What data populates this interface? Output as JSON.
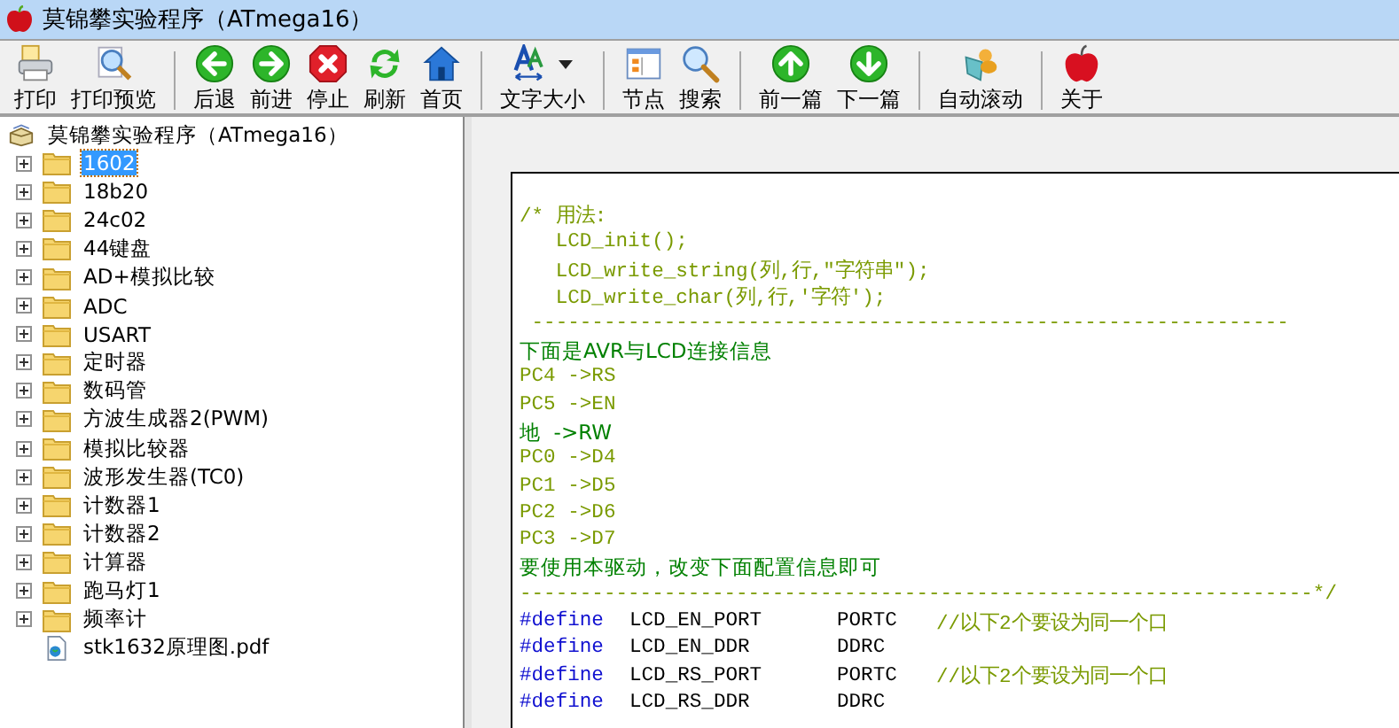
{
  "window": {
    "title": "莫锦攀实验程序（ATmega16）"
  },
  "toolbar": {
    "groups": [
      [
        {
          "label": "打印"
        },
        {
          "label": "打印预览"
        }
      ],
      [
        {
          "label": "后退"
        },
        {
          "label": "前进"
        },
        {
          "label": "停止"
        },
        {
          "label": "刷新"
        },
        {
          "label": "首页"
        }
      ],
      [
        {
          "label": "文字大小",
          "dropdown": true
        }
      ],
      [
        {
          "label": "节点"
        },
        {
          "label": "搜索"
        }
      ],
      [
        {
          "label": "前一篇"
        },
        {
          "label": "下一篇"
        }
      ],
      [
        {
          "label": "自动滚动"
        }
      ],
      [
        {
          "label": "关于"
        }
      ]
    ]
  },
  "tree": {
    "root": {
      "label": "莫锦攀实验程序（ATmega16）",
      "children": [
        {
          "label": "1602",
          "kind": "folder",
          "expanded": false,
          "selected": true
        },
        {
          "label": "18b20",
          "kind": "folder",
          "expanded": false,
          "selected": false
        },
        {
          "label": "24c02",
          "kind": "folder",
          "expanded": false,
          "selected": false
        },
        {
          "label": "44键盘",
          "kind": "folder",
          "expanded": false,
          "selected": false
        },
        {
          "label": "AD+模拟比较",
          "kind": "folder",
          "expanded": false,
          "selected": false
        },
        {
          "label": "ADC",
          "kind": "folder",
          "expanded": false,
          "selected": false
        },
        {
          "label": "USART",
          "kind": "folder",
          "expanded": false,
          "selected": false
        },
        {
          "label": "定时器",
          "kind": "folder",
          "expanded": false,
          "selected": false
        },
        {
          "label": "数码管",
          "kind": "folder",
          "expanded": false,
          "selected": false
        },
        {
          "label": "方波生成器2(PWM)",
          "kind": "folder",
          "expanded": false,
          "selected": false
        },
        {
          "label": "模拟比较器",
          "kind": "folder",
          "expanded": false,
          "selected": false
        },
        {
          "label": "波形发生器(TC0)",
          "kind": "folder",
          "expanded": false,
          "selected": false
        },
        {
          "label": "计数器1",
          "kind": "folder",
          "expanded": false,
          "selected": false
        },
        {
          "label": "计数器2",
          "kind": "folder",
          "expanded": false,
          "selected": false
        },
        {
          "label": "计算器",
          "kind": "folder",
          "expanded": false,
          "selected": false
        },
        {
          "label": "跑马灯1",
          "kind": "folder",
          "expanded": false,
          "selected": false
        },
        {
          "label": "频率计",
          "kind": "folder",
          "expanded": false,
          "selected": false
        },
        {
          "label": "stk1632原理图.pdf",
          "kind": "file",
          "selected": false
        }
      ]
    }
  },
  "code": {
    "lines": [
      {
        "kind": "comment",
        "text": "/* 用法:"
      },
      {
        "kind": "comment",
        "text": "   LCD_init();"
      },
      {
        "kind": "comment",
        "text": "   LCD_write_string(列,行,\"字符串\");"
      },
      {
        "kind": "comment",
        "text": "   LCD_write_char(列,行,'字符');"
      },
      {
        "kind": "comment",
        "text": " ---------------------------------------------------------------"
      },
      {
        "kind": "note",
        "text": "下面是AVR与LCD连接信息"
      },
      {
        "kind": "comment",
        "text": "PC4 ->RS"
      },
      {
        "kind": "comment",
        "text": "PC5 ->EN"
      },
      {
        "kind": "note",
        "text": "地  ->RW"
      },
      {
        "kind": "comment",
        "text": "PC0 ->D4"
      },
      {
        "kind": "comment",
        "text": "PC1 ->D5"
      },
      {
        "kind": "comment",
        "text": "PC2 ->D6"
      },
      {
        "kind": "comment",
        "text": "PC3 ->D7"
      },
      {
        "kind": "note",
        "text": "要使用本驱动，改变下面配置信息即可"
      },
      {
        "kind": "comment",
        "text": "------------------------------------------------------------------*/"
      },
      {
        "kind": "define",
        "keyword": "#define",
        "name": "LCD_EN_PORT",
        "value": "PORTC",
        "comment": "//以下2个要设为同一个口"
      },
      {
        "kind": "define",
        "keyword": "#define",
        "name": "LCD_EN_DDR",
        "value": "DDRC"
      },
      {
        "kind": "define",
        "keyword": "#define",
        "name": "LCD_RS_PORT",
        "value": "PORTC",
        "comment": "//以下2个要设为同一个口"
      },
      {
        "kind": "define",
        "keyword": "#define",
        "name": "LCD_RS_DDR",
        "value": "DDRC"
      }
    ]
  }
}
